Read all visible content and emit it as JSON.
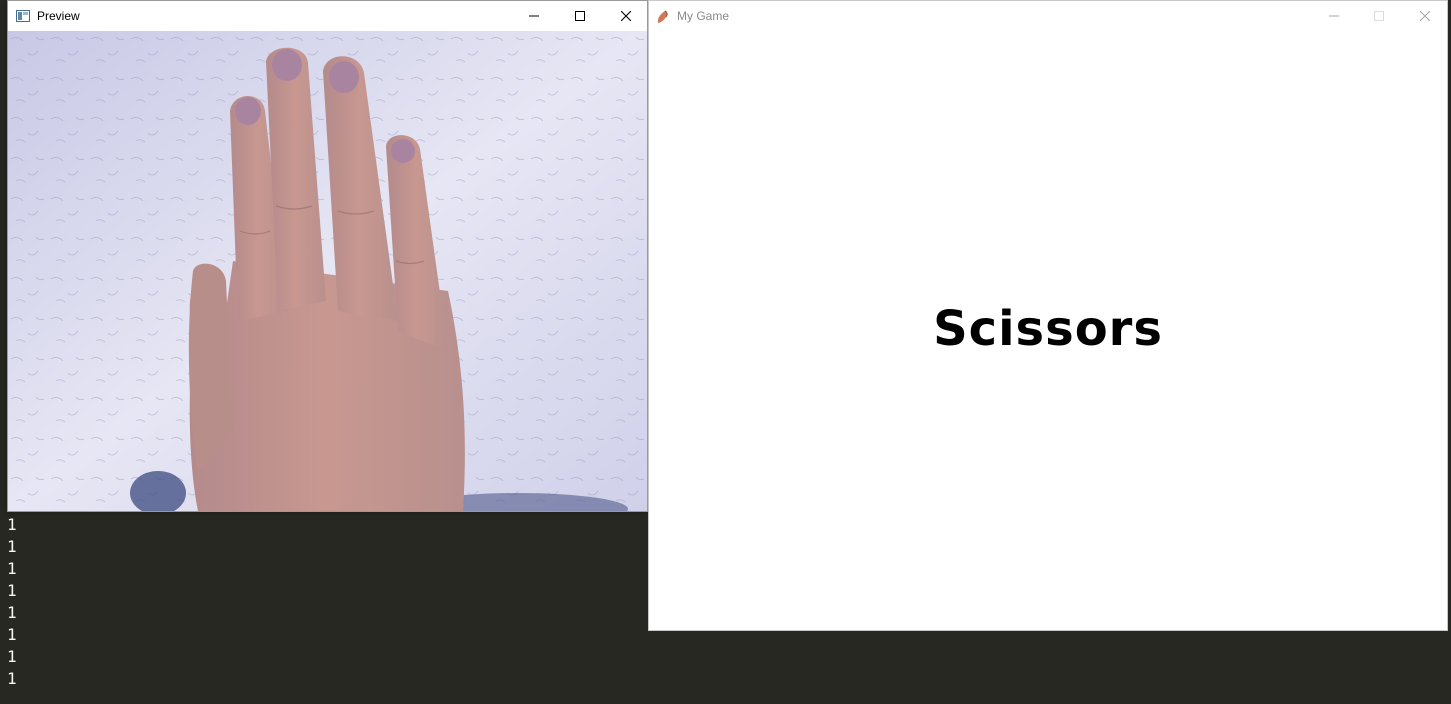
{
  "preview_window": {
    "title": "Preview",
    "icon": "window-app-icon",
    "controls": [
      "minimize-icon",
      "maximize-icon",
      "close-icon"
    ]
  },
  "game_window": {
    "title": "My Game",
    "icon": "game-app-icon",
    "controls": [
      "minimize-icon",
      "maximize-icon",
      "close-icon"
    ],
    "gesture_text": "Scissors"
  },
  "terminal": {
    "lines": [
      "1",
      "1",
      "1",
      "1",
      "1",
      "1",
      "1",
      "1"
    ]
  },
  "colors": {
    "terminal_bg": "#272822",
    "terminal_fg": "#f8f8f2",
    "wall": "#dcdcef",
    "skin": "#c89890"
  }
}
